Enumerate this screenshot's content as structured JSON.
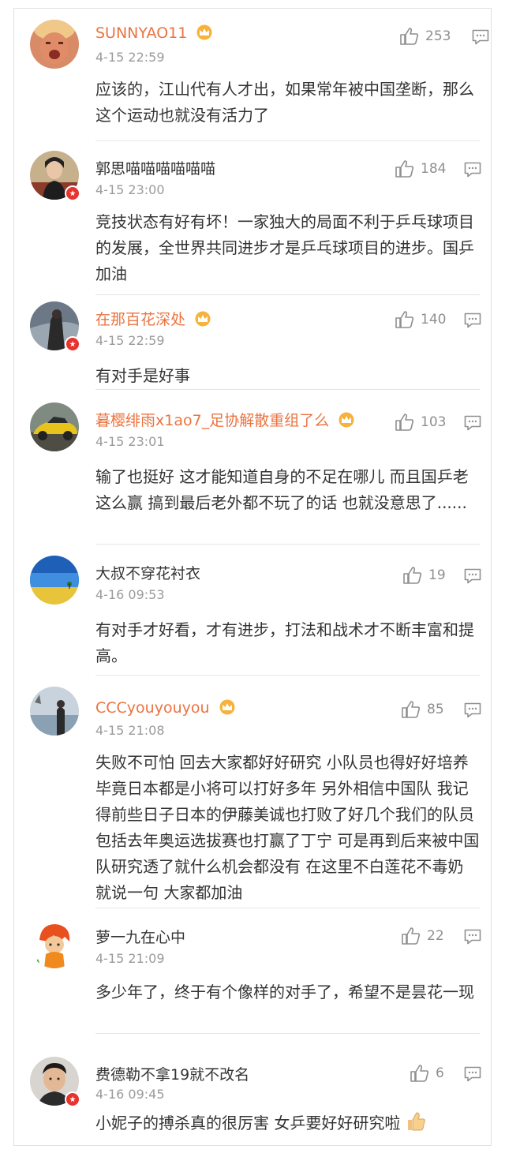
{
  "comments": [
    {
      "name": "SUNNYAO11",
      "time": "4-15 22:59",
      "likes": "253",
      "vip": true,
      "verified": false,
      "text": "应该的，江山代有人才出，如果常年被中国垄断，那么这个运动也就没有活力了"
    },
    {
      "name": "郭思喵喵喵喵喵喵",
      "time": "4-15 23:00",
      "likes": "184",
      "vip": false,
      "verified": true,
      "text": "竞技状态有好有坏！一家独大的局面不利于乒乓球项目的发展，全世界共同进步才是乒乓球项目的进步。国乒加油"
    },
    {
      "name": "在那百花深处",
      "time": "4-15 22:59",
      "likes": "140",
      "vip": true,
      "verified": true,
      "text": "有对手是好事"
    },
    {
      "name": "暮樱绯雨x1ao7_足协解散重组了么",
      "time": "4-15 23:01",
      "likes": "103",
      "vip": true,
      "verified": false,
      "text": "输了也挺好 这才能知道自身的不足在哪儿 而且国乒老这么赢 搞到最后老外都不玩了的话 也就没意思了......"
    },
    {
      "name": "大叔不穿花衬衣",
      "time": "4-16 09:53",
      "likes": "19",
      "vip": false,
      "verified": false,
      "text": "有对手才好看，才有进步，打法和战术才不断丰富和提高。"
    },
    {
      "name": "CCCyouyouyou",
      "time": "4-15 21:08",
      "likes": "85",
      "vip": true,
      "verified": false,
      "text": "失败不可怕 回去大家都好好研究 小队员也得好好培养 毕竟日本都是小将可以打好多年 另外相信中国队 我记得前些日子日本的伊藤美诚也打败了好几个我们的队员 包括去年奥运选拔赛也打赢了丁宁 可是再到后来被中国队研究透了就什么机会都没有 在这里不白莲花不毒奶 就说一句 大家都加油"
    },
    {
      "name": "萝一九在心中",
      "time": "4-15 21:09",
      "likes": "22",
      "vip": false,
      "verified": false,
      "text": "多少年了，终于有个像样的对手了，希望不是昙花一现"
    },
    {
      "name": "费德勒不拿19就不改名",
      "time": "4-16 09:45",
      "likes": "6",
      "vip": false,
      "verified": true,
      "text": "小妮子的搏杀真的很厉害 女乒要好好研究啦"
    }
  ],
  "colors": {
    "vip_name": "#eb7340",
    "normal_name": "#333333",
    "time": "#9b9b9b",
    "icon": "#8f8f8f",
    "verified_badge": "#e8322d"
  },
  "icons": {
    "like": "thumbs-up-icon",
    "reply": "comment-bubble-icon",
    "vip": "crown-icon",
    "verified": "verified-badge-icon",
    "emoji": "thumbs-up-emoji"
  }
}
